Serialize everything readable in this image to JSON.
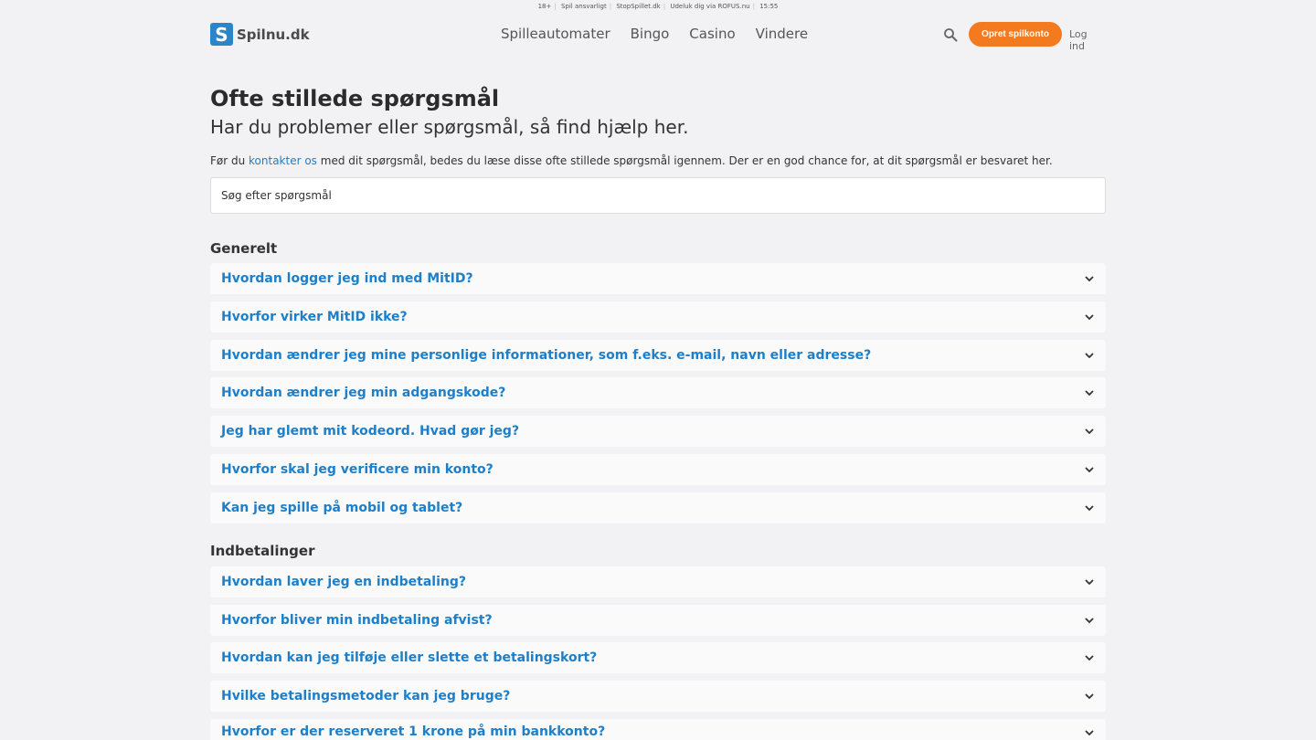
{
  "topbar": {
    "age": "18+",
    "responsible": "Spil ansvarligt",
    "stop": "StopSpillet.dk",
    "rofus": "Udeluk dig via ROFUS.nu",
    "time": "15:55"
  },
  "header": {
    "logo_letter": "S",
    "logo_text": "Spilnu.dk",
    "nav": [
      "Spilleautomater",
      "Bingo",
      "Casino",
      "Vindere"
    ],
    "create_account": "Opret spilkonto",
    "login": "Log ind"
  },
  "page": {
    "title": "Ofte stillede spørgsmål",
    "subtitle": "Har du problemer eller spørgsmål, så find hjælp her.",
    "intro_before": "Før du ",
    "intro_link": "kontakter os",
    "intro_after": " med dit spørgsmål, bedes du læse disse ofte stillede spørgsmål igennem. Der er en god chance for, at dit spørgsmål er besvaret her.",
    "search_placeholder": "Søg efter spørgsmål"
  },
  "sections": [
    {
      "title": "Generelt",
      "questions": [
        "Hvordan logger jeg ind med MitID?",
        "Hvorfor virker MitID ikke?",
        "Hvordan ændrer jeg mine personlige informationer, som f.eks. e-mail, navn eller adresse?",
        "Hvordan ændrer jeg min adgangskode?",
        "Jeg har glemt mit kodeord. Hvad gør jeg?",
        "Hvorfor skal jeg verificere min konto?",
        "Kan jeg spille på mobil og tablet?"
      ]
    },
    {
      "title": "Indbetalinger",
      "questions": [
        "Hvordan laver jeg en indbetaling?",
        "Hvorfor bliver min indbetaling afvist?",
        "Hvordan kan jeg tilføje eller slette et betalingskort?",
        "Hvilke betalingsmetoder kan jeg bruge?",
        "Hvorfor er der reserveret 1 krone på min bankkonto?"
      ]
    }
  ],
  "colors": {
    "accent": "#1d7fc9",
    "cta": "#f47a20",
    "background": "#f2f2f4"
  }
}
